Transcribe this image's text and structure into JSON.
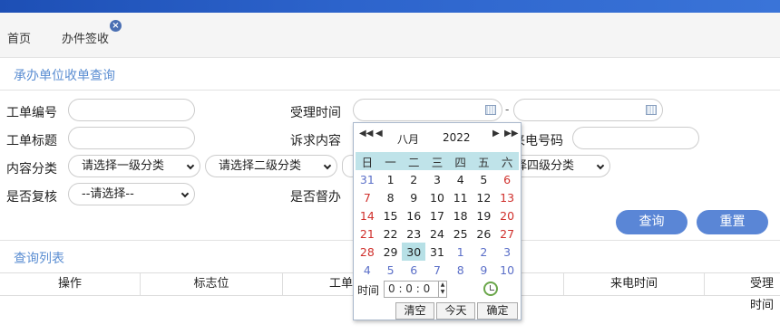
{
  "tabs": {
    "home": "首页",
    "active": "办件签收"
  },
  "search_section": {
    "title": "承办单位收单查询"
  },
  "form": {
    "ticket_no_label": "工单编号",
    "accept_time_label": "受理时间",
    "dash": "-",
    "ticket_title_label": "工单标题",
    "request_content_label": "诉求内容",
    "caller_no_label": "来电号码",
    "content_category_label": "内容分类",
    "cat1": "请选择一级分类",
    "cat2": "请选择二级分类",
    "cat4": "请选择四级分类",
    "recheck_label": "是否复核",
    "recheck_value": "--请选择--",
    "supervise_label": "是否督办"
  },
  "buttons": {
    "query": "查询",
    "reset": "重置"
  },
  "list_section": {
    "title": "查询列表"
  },
  "table": {
    "headers": [
      "操作",
      "标志位",
      "工单编号",
      "来电时间",
      "受理时间"
    ]
  },
  "calendar": {
    "month": "八月",
    "year": "2022",
    "weekdays": [
      "日",
      "一",
      "二",
      "三",
      "四",
      "五",
      "六"
    ],
    "weeks": [
      [
        "31",
        "1",
        "2",
        "3",
        "4",
        "5",
        "6"
      ],
      [
        "7",
        "8",
        "9",
        "10",
        "11",
        "12",
        "13"
      ],
      [
        "14",
        "15",
        "16",
        "17",
        "18",
        "19",
        "20"
      ],
      [
        "21",
        "22",
        "23",
        "24",
        "25",
        "26",
        "27"
      ],
      [
        "28",
        "29",
        "30",
        "31",
        "1",
        "2",
        "3"
      ],
      [
        "4",
        "5",
        "6",
        "7",
        "8",
        "9",
        "10"
      ]
    ],
    "time_label": "时间",
    "time_value": "0 : 0 : 0",
    "clear": "清空",
    "today": "今天",
    "ok": "确定",
    "prev_year": "◀◀",
    "prev_month": "◀",
    "next_month": "▶",
    "next_year": "▶▶"
  }
}
